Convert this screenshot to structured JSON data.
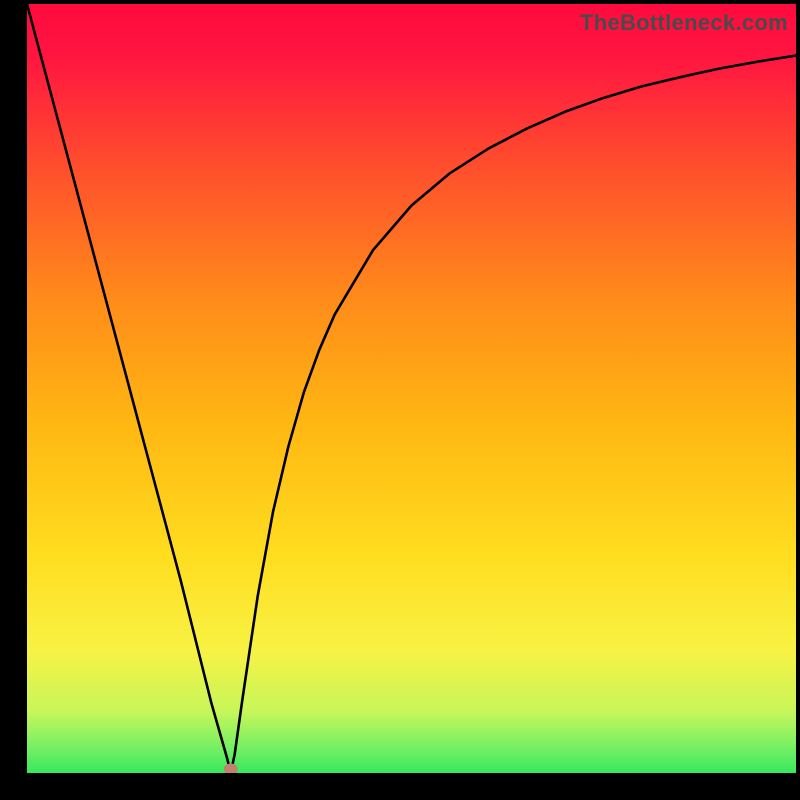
{
  "watermark": "TheBottleneck.com",
  "chart_data": {
    "type": "line",
    "x": [
      0.0,
      0.02,
      0.04,
      0.06,
      0.08,
      0.1,
      0.12,
      0.14,
      0.16,
      0.18,
      0.2,
      0.22,
      0.24,
      0.26,
      0.265,
      0.27,
      0.28,
      0.3,
      0.32,
      0.34,
      0.36,
      0.38,
      0.4,
      0.45,
      0.5,
      0.55,
      0.6,
      0.65,
      0.7,
      0.75,
      0.8,
      0.85,
      0.9,
      0.95,
      1.0
    ],
    "series": [
      {
        "name": "curve",
        "values": [
          1.0,
          0.925,
          0.85,
          0.775,
          0.7,
          0.625,
          0.55,
          0.475,
          0.4,
          0.325,
          0.25,
          0.17,
          0.09,
          0.02,
          0.0,
          0.024,
          0.095,
          0.23,
          0.34,
          0.425,
          0.495,
          0.55,
          0.596,
          0.68,
          0.738,
          0.78,
          0.812,
          0.838,
          0.86,
          0.878,
          0.893,
          0.905,
          0.916,
          0.925,
          0.933
        ]
      }
    ],
    "marker": {
      "x": 0.265,
      "y": 0.0,
      "color": "#c0816f"
    },
    "title": "",
    "xlabel": "",
    "ylabel": "",
    "xlim": [
      0,
      1
    ],
    "ylim": [
      0,
      1
    ],
    "background_gradient": [
      "#ff0a3e",
      "#ffd400",
      "#36e85d"
    ],
    "grid": false,
    "annotations": []
  }
}
